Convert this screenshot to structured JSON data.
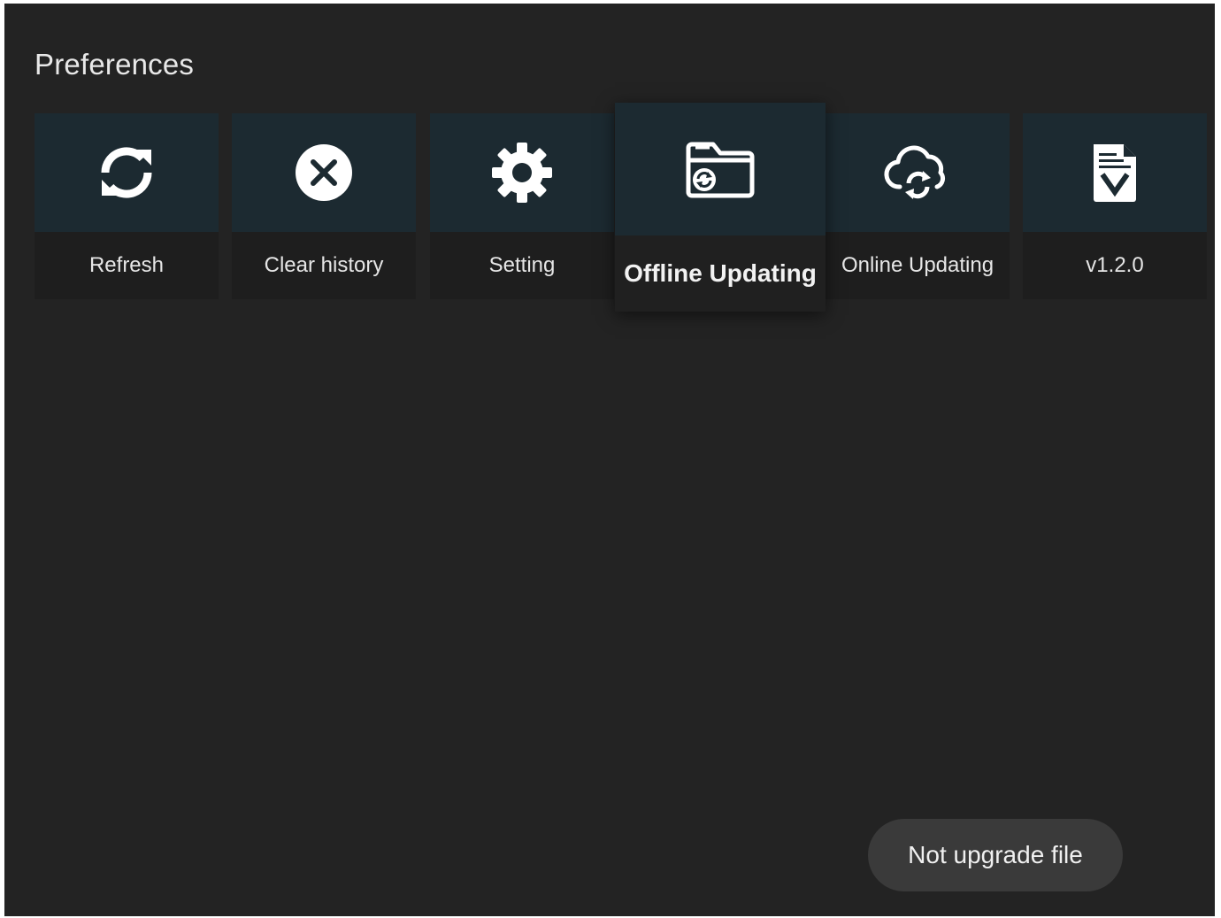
{
  "page": {
    "title": "Preferences"
  },
  "tiles": [
    {
      "label": "Refresh",
      "icon": "refresh-icon"
    },
    {
      "label": "Clear history",
      "icon": "close-circle-icon"
    },
    {
      "label": "Setting",
      "icon": "gear-icon"
    },
    {
      "label": "Offline Updating",
      "icon": "folder-sync-icon",
      "focused": true
    },
    {
      "label": "Online Updating",
      "icon": "cloud-sync-icon"
    },
    {
      "label": "v1.2.0",
      "icon": "version-file-icon"
    }
  ],
  "toast": {
    "text": "Not upgrade file"
  },
  "colors": {
    "background": "#232323",
    "tile_icon_bg": "#1c2a31",
    "tile_label_bg": "#1e1e1e",
    "text": "#e6e6e6",
    "toast_bg": "#3a3a3a"
  }
}
